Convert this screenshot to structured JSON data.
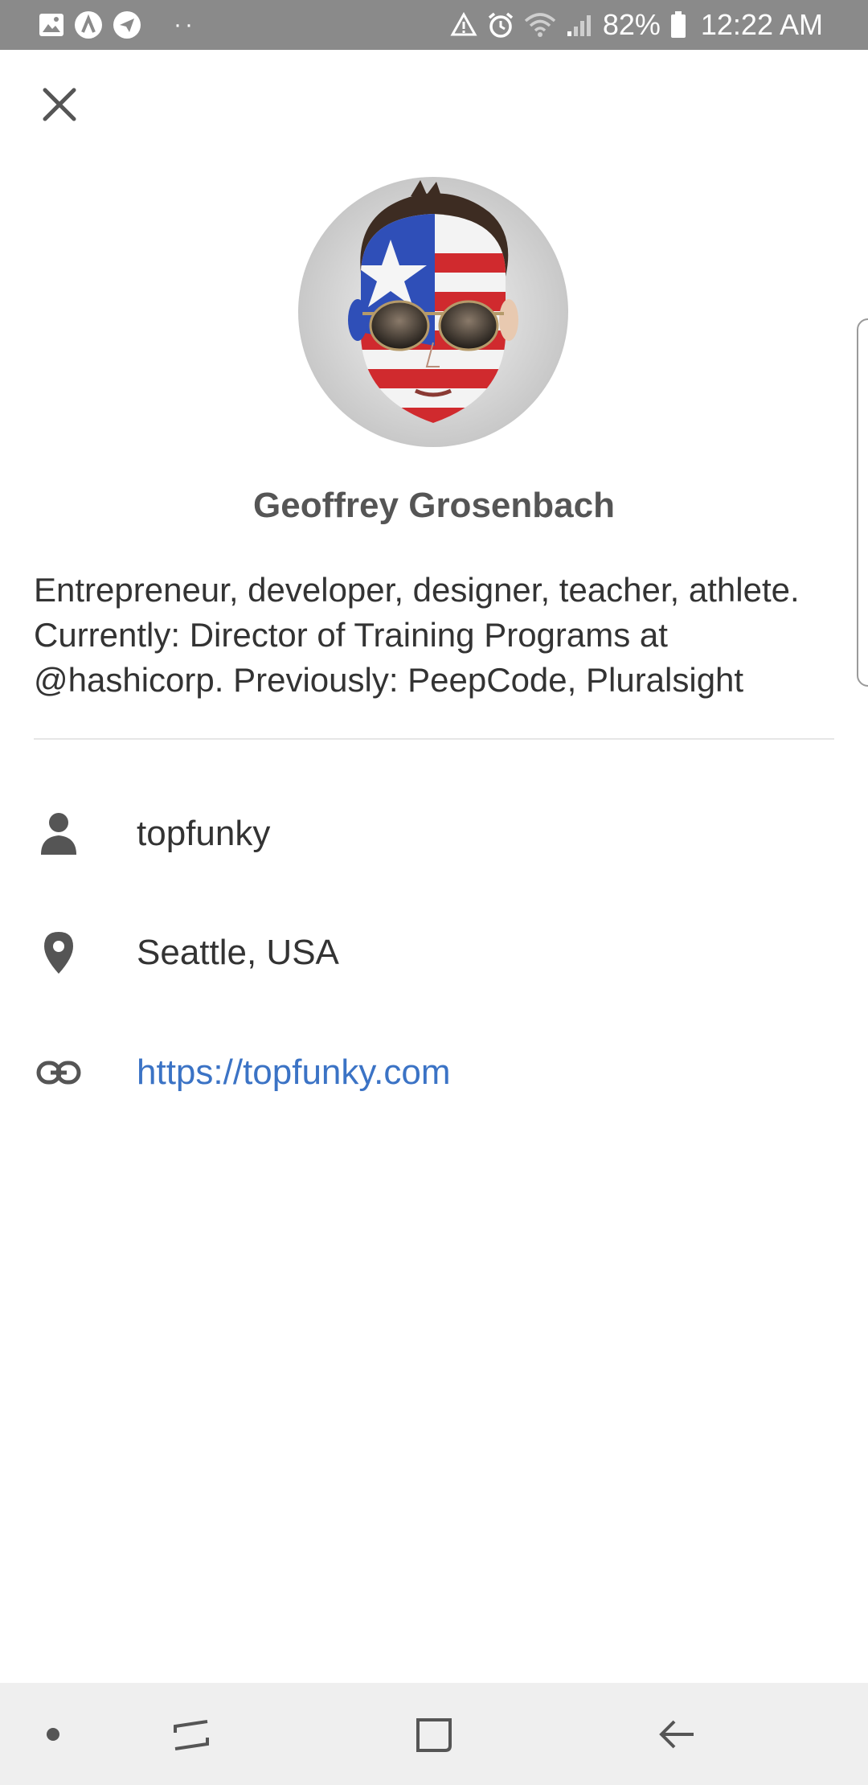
{
  "status_bar": {
    "battery_percent": "82%",
    "time": "12:22 AM",
    "more_indicator": "··",
    "left_icons": [
      "gallery-icon",
      "app-lambda-icon",
      "telegram-icon"
    ],
    "right_icons": [
      "sync-alert-icon",
      "alarm-icon",
      "wifi-icon",
      "signal-icon",
      "battery-icon"
    ]
  },
  "profile": {
    "close_icon": "close-icon",
    "avatar_description": "avatar",
    "name": "Geoffrey Grosenbach",
    "bio": "Entrepreneur, developer, designer, teacher, ath­lete. Currently: Director of Training Programs at @hashicorp. Previously: PeepCode, Pluralsight",
    "details": [
      {
        "icon": "user-icon",
        "text": "topfunky"
      },
      {
        "icon": "location-pin-icon",
        "text": "Seattle, USA"
      },
      {
        "icon": "link-icon",
        "text": "https://topfunky.com"
      }
    ],
    "colors": {
      "link": "#3b73c5",
      "name": "#555555",
      "text": "#333333",
      "icon": "#555555",
      "status_bar": "#8a8a8a",
      "nav_bar": "#efefef"
    }
  },
  "nav_bar": {
    "items": [
      "nav-dot-icon",
      "recent-apps-icon",
      "home-icon",
      "back-icon"
    ]
  }
}
